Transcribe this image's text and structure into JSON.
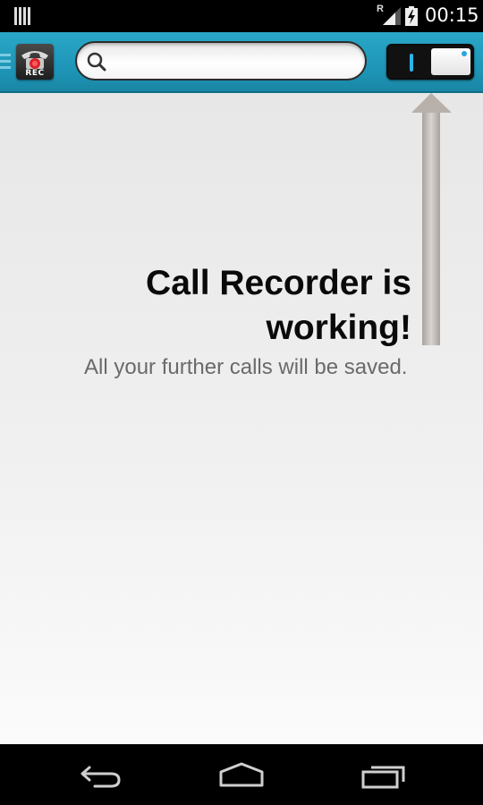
{
  "status_bar": {
    "time": "00:15",
    "roaming_indicator": "R",
    "icons": [
      "notification-bars-icon",
      "signal-icon",
      "battery-charging-icon"
    ]
  },
  "app_bar": {
    "logo_text": "REC",
    "search": {
      "value": "",
      "placeholder": ""
    },
    "toggle": {
      "state": "on"
    }
  },
  "content": {
    "headline_line1": "Call Recorder is",
    "headline_line2": "working!",
    "subtext": "All your further calls will be saved."
  },
  "nav_bar": {
    "icons": [
      "back-icon",
      "home-icon",
      "recent-apps-icon"
    ]
  },
  "colors": {
    "app_bar": "#1d93b4",
    "toggle_accent": "#2bb5ea",
    "background_top": "#e7e7e7",
    "background_bottom": "#fbfbfb",
    "headline": "#0a0a0a",
    "subtext": "#6a6a6a"
  }
}
